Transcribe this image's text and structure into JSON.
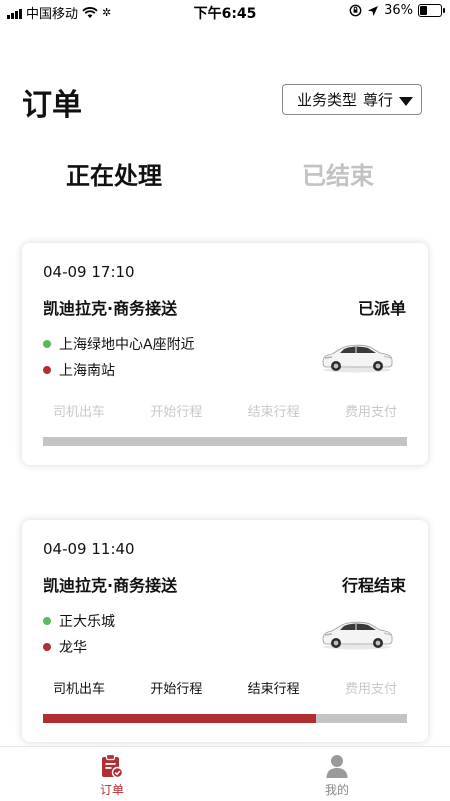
{
  "status_bar": {
    "carrier": "中国移动",
    "time": "下午6:45",
    "battery": "36%",
    "battery_level": 0.36
  },
  "header": {
    "title": "订单",
    "business_type_label": "业务类型",
    "business_type_value": "尊行"
  },
  "tabs": [
    {
      "label": "正在处理",
      "active": true
    },
    {
      "label": "已结束",
      "active": false
    }
  ],
  "orders": [
    {
      "time": "04-09 17:10",
      "service": "凯迪拉克·商务接送",
      "status": "已派单",
      "pickup": "上海绿地中心A座附近",
      "dropoff": "上海南站",
      "steps": [
        "司机出车",
        "开始行程",
        "结束行程",
        "费用支付"
      ],
      "completed_steps": 0,
      "progress": 0
    },
    {
      "time": "04-09 11:40",
      "service": "凯迪拉克·商务接送",
      "status": "行程结束",
      "pickup": "正大乐城",
      "dropoff": "龙华",
      "steps": [
        "司机出车",
        "开始行程",
        "结束行程",
        "费用支付"
      ],
      "completed_steps": 3,
      "progress": 0.75
    }
  ],
  "bottom_nav": [
    {
      "label": "订单",
      "icon": "clipboard-check-icon",
      "active": true
    },
    {
      "label": "我的",
      "icon": "person-icon",
      "active": false
    }
  ],
  "colors": {
    "accent": "#b12e33",
    "pickup_dot": "#5cb85c",
    "dropoff_dot": "#b12e33",
    "step_done": "#111111",
    "step_pending": "#c8c8c8",
    "tab_inactive": "#c2c2c2"
  }
}
